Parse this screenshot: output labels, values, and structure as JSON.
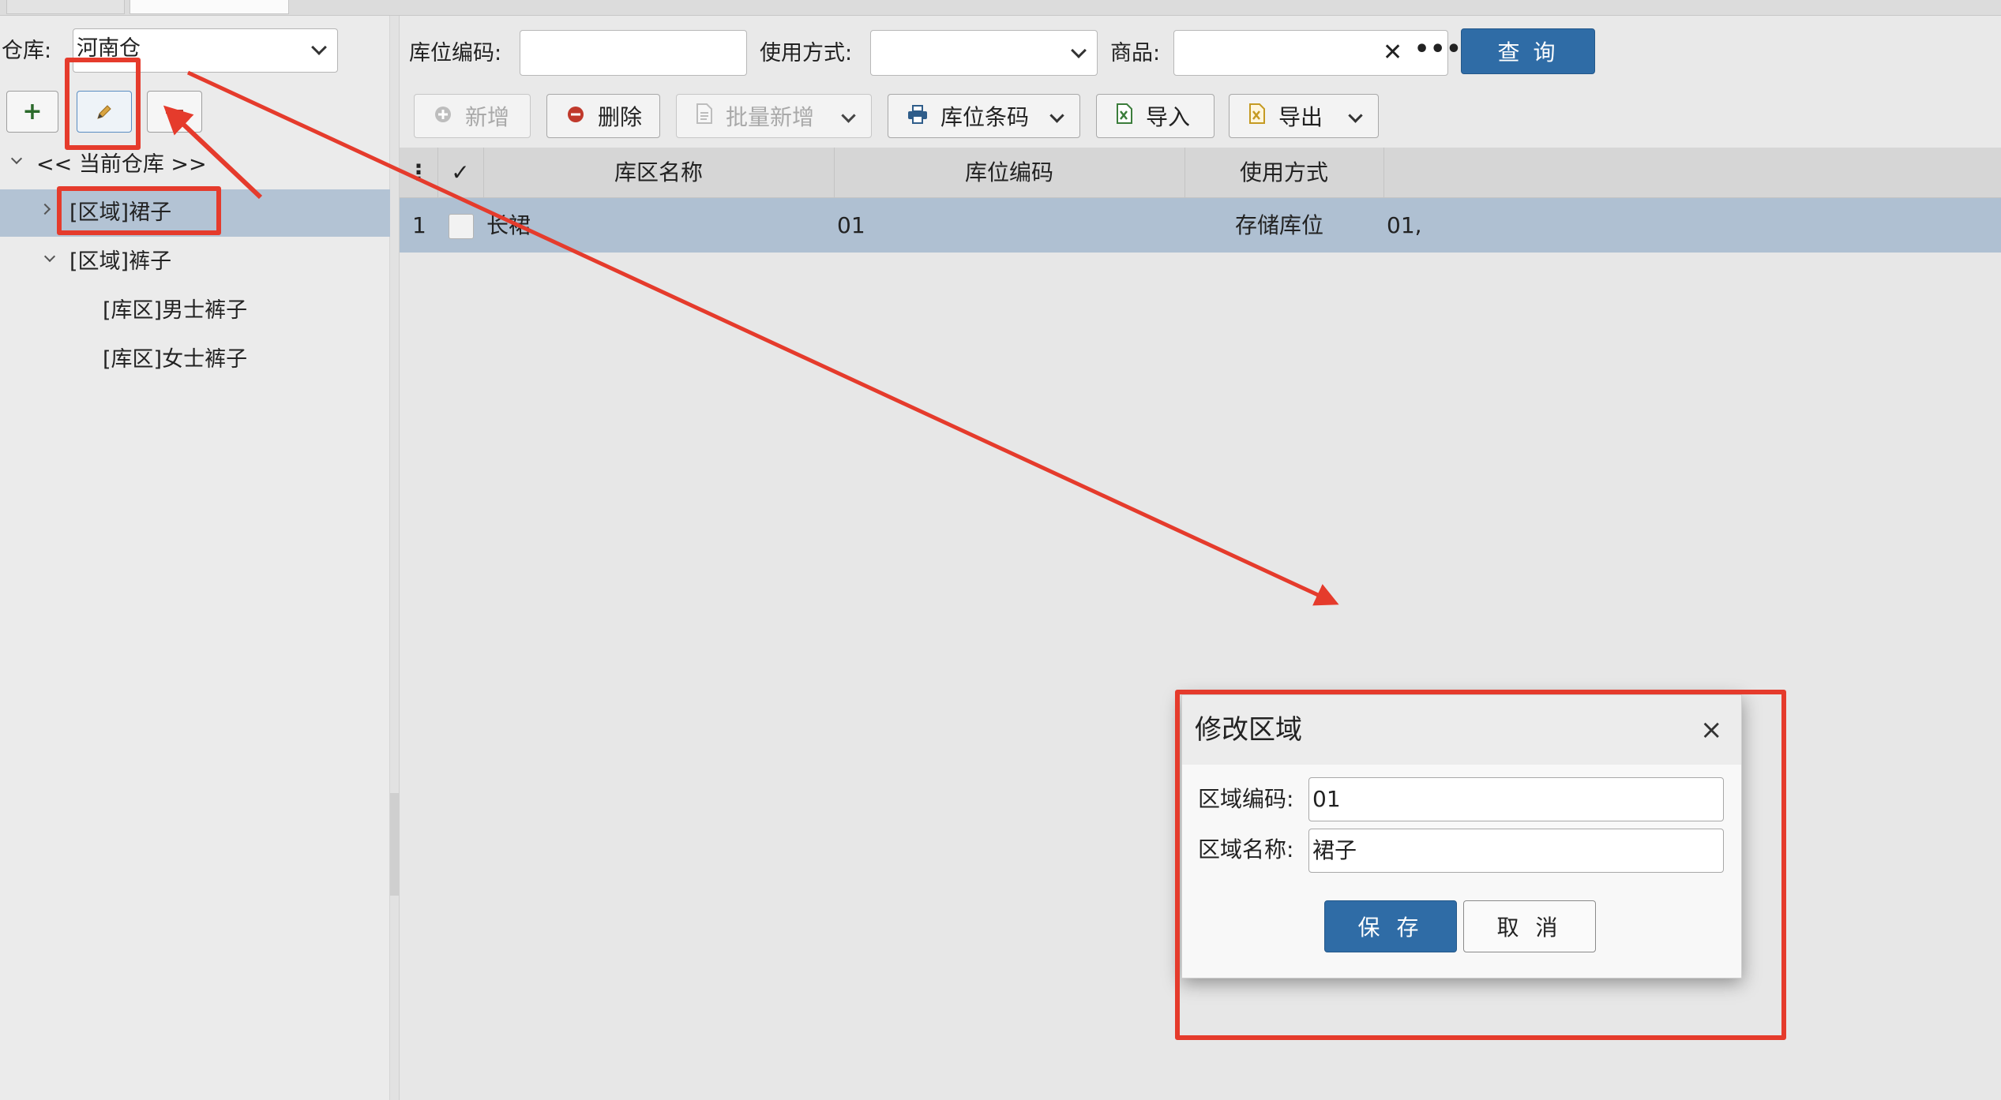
{
  "left": {
    "warehouse_label": "仓库:",
    "warehouse_value": "河南仓",
    "tree": {
      "root": "<< 当前仓库 >>",
      "nodes": [
        "[区域]裙子",
        "[区域]裤子",
        "[库区]男士裤子",
        "[库区]女士裤子"
      ]
    }
  },
  "filters": {
    "location_code_label": "库位编码:",
    "usage_label": "使用方式:",
    "product_label": "商品:",
    "query_button": "查 询"
  },
  "toolbar": {
    "add": "新增",
    "delete": "删除",
    "batch_add": "批量新增",
    "barcode": "库位条码",
    "import": "导入",
    "export": "导出"
  },
  "grid": {
    "headers": [
      "库区名称",
      "库位编码",
      "使用方式"
    ],
    "rows": [
      {
        "index": "1",
        "zone_name": "长裙",
        "location_code": "01",
        "usage": "存储库位",
        "extra": "01,"
      }
    ]
  },
  "dialog": {
    "title": "修改区域",
    "code_label": "区域编码:",
    "code_value": "01",
    "name_label": "区域名称:",
    "name_value": "裙子",
    "save": "保 存",
    "cancel": "取 消"
  },
  "colors": {
    "primary": "#2f6ca6",
    "selected_row": "#afc0d2",
    "annotation_red": "#e53b2c"
  }
}
